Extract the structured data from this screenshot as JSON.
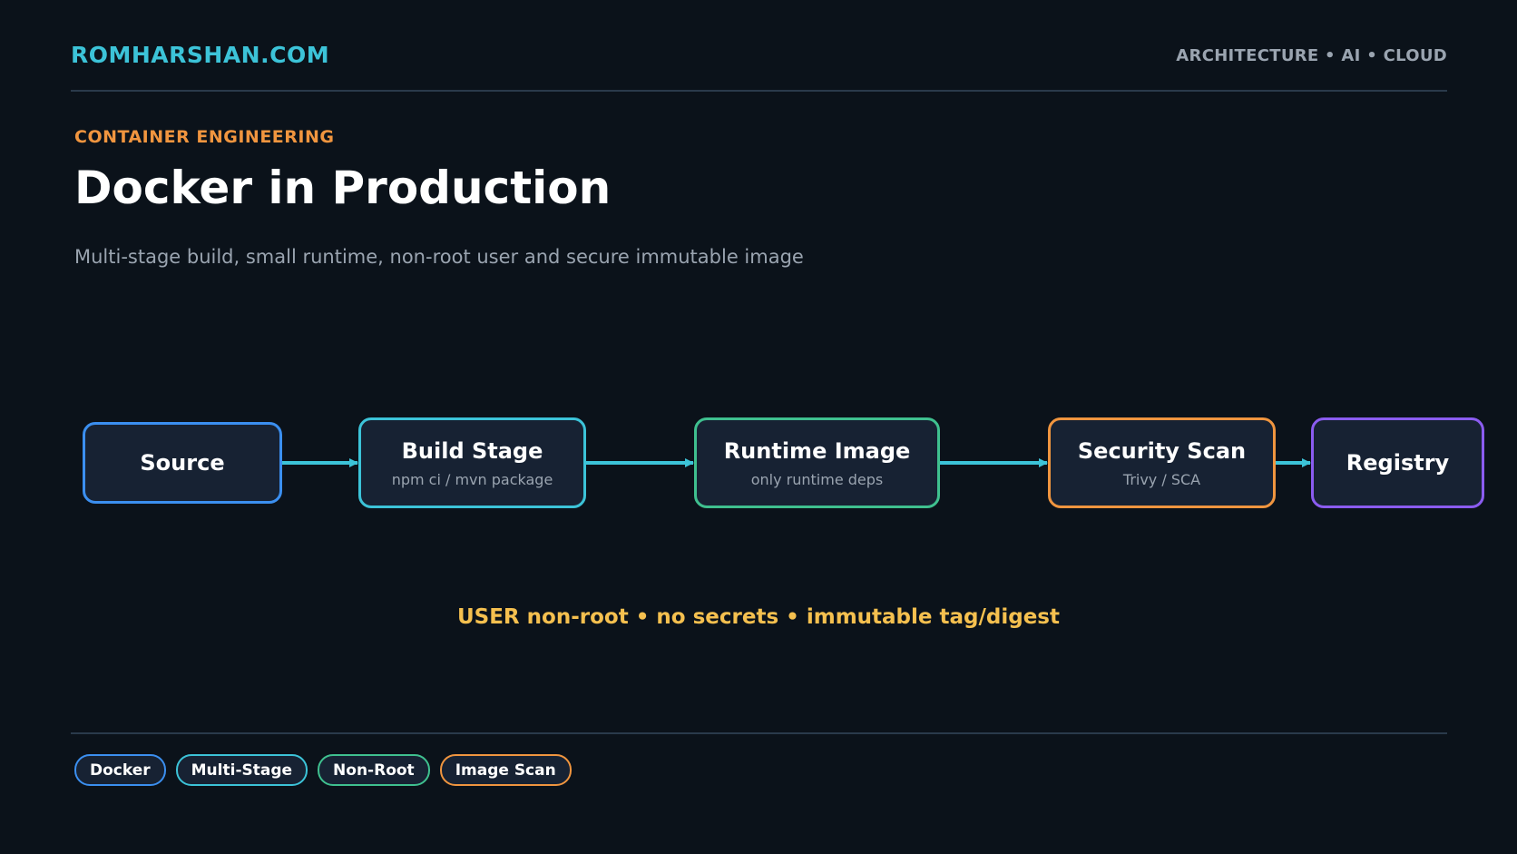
{
  "header": {
    "brand": "ROMHARSHAN.COM",
    "topics": "ARCHITECTURE • AI • CLOUD"
  },
  "hero": {
    "kicker": "CONTAINER ENGINEERING",
    "title": "Docker in Production",
    "subtitle": "Multi-stage build, small runtime, non-root user and secure immutable image"
  },
  "pipeline": {
    "stages": [
      {
        "label": "Source",
        "sub": "",
        "color": "#3b8ff0"
      },
      {
        "label": "Build Stage",
        "sub": "npm ci / mvn package",
        "color": "#3cc3d8"
      },
      {
        "label": "Runtime Image",
        "sub": "only runtime deps",
        "color": "#3fc08f"
      },
      {
        "label": "Security Scan",
        "sub": "Trivy / SCA",
        "color": "#f0953f"
      },
      {
        "label": "Registry",
        "sub": "",
        "color": "#8b5cf0"
      }
    ],
    "arrow_color": "#3cc3d8"
  },
  "tagline": "USER non-root • no secrets • immutable tag/digest",
  "chips": [
    {
      "label": "Docker",
      "color": "#3b8ff0"
    },
    {
      "label": "Multi-Stage",
      "color": "#3cc3d8"
    },
    {
      "label": "Non-Root",
      "color": "#3fc08f"
    },
    {
      "label": "Image Scan",
      "color": "#f0953f"
    }
  ]
}
